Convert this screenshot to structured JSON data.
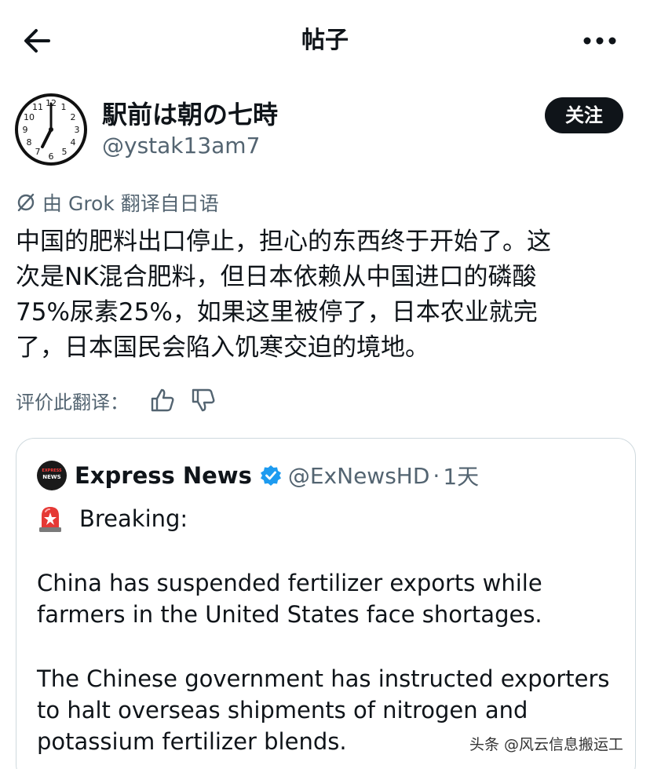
{
  "header": {
    "back_icon": "arrow-left-icon",
    "title": "帖子",
    "more_icon": "more-horizontal-icon"
  },
  "post": {
    "author": {
      "name": "駅前は朝の七時",
      "handle": "@ystak13am7",
      "avatar_icon": "clock-avatar-icon"
    },
    "follow_label": "关注",
    "translation_note": "由 Grok 翻译自日语",
    "translation_icon": "grok-icon",
    "body_lines": [
      "中国的肥料出口停止，担心的东西终于开始了。这",
      "次是NK混合肥料，但日本依赖从中国进口的磷酸",
      "75%尿素25%，如果这里被停了，日本农业就完",
      "了，日本国民会陷入饥寒交迫的境地。"
    ],
    "rate_label": "评价此翻译：",
    "rate_icons": [
      "thumbs-up-icon",
      "thumbs-down-icon"
    ]
  },
  "quote": {
    "avatar_text_1": "EXPRESS",
    "avatar_text_2": "NEWS",
    "name": "Express News",
    "verified_icon": "verified-badge-icon",
    "handle": "@ExNewsHD",
    "separator": "·",
    "time": "1天",
    "siren_icon": "siren-icon",
    "breaking": "Breaking:",
    "para1_lines": [
      "China has suspended fertilizer exports while",
      "farmers in the United States face shortages."
    ],
    "para2_lines": [
      "The Chinese government has instructed exporters",
      "to halt overseas shipments of nitrogen and",
      "potassium fertilizer blends."
    ]
  },
  "watermark": "头条 @风云信息搬运工",
  "colors": {
    "text_primary": "#0f1419",
    "text_secondary": "#536471",
    "follow_bg": "#0f1419",
    "verified_blue": "#1d9bf0",
    "card_border": "#cfd9de"
  }
}
